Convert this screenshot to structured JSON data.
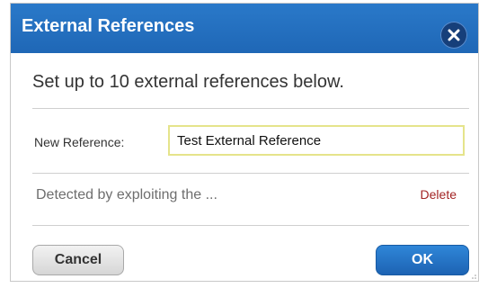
{
  "dialog": {
    "title": "External References",
    "intro": "Set up to 10 external references below.",
    "new_reference_label": "New Reference:",
    "new_reference_value": "Test External Reference",
    "references": [
      {
        "text": "Detected by exploiting the ...",
        "delete_label": "Delete"
      }
    ],
    "cancel_label": "Cancel",
    "ok_label": "OK",
    "close_icon": "close-icon"
  },
  "colors": {
    "titlebar": "#2473c3",
    "ok_button": "#2478c9",
    "delete_link": "#a32424",
    "input_border": "#e5e48b"
  }
}
